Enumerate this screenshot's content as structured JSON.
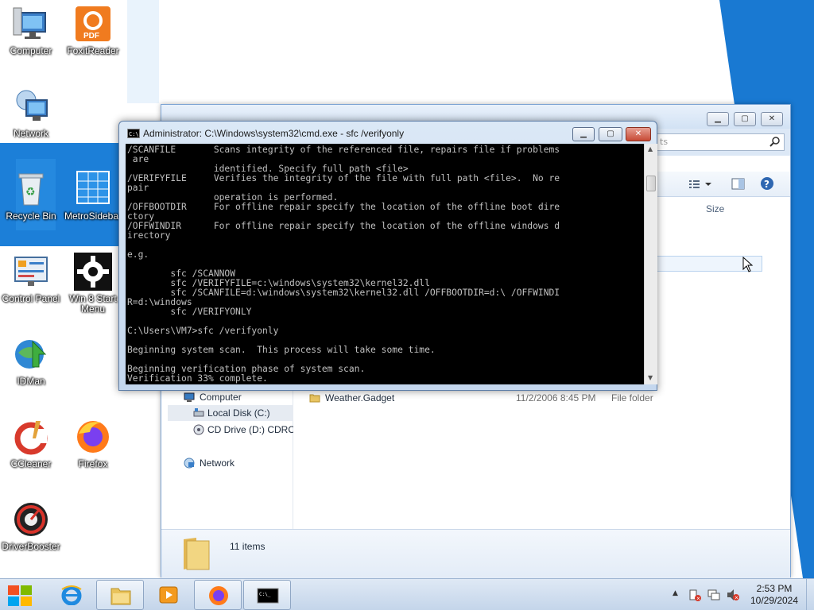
{
  "desktop": {
    "icons": [
      {
        "label": "Computer"
      },
      {
        "label": "FoxitReader"
      },
      {
        "label": "Network"
      },
      {
        "label": "Recycle Bin"
      },
      {
        "label": "MetroSidebar"
      },
      {
        "label": "Control Panel"
      },
      {
        "label": "Win 8 Start Menu"
      },
      {
        "label": "IDMan"
      },
      {
        "label": "CCleaner"
      },
      {
        "label": "Firefox"
      },
      {
        "label": "DriverBooster"
      }
    ]
  },
  "explorer": {
    "search_placeholder": "ts",
    "column_size": "Size",
    "sidebar": [
      {
        "label": "Computer",
        "icon": "computer-icon"
      },
      {
        "label": "Local Disk (C:)",
        "icon": "drive-icon"
      },
      {
        "label": "CD Drive (D:) CDROM",
        "icon": "cd-drive-icon"
      },
      {
        "label": "Network",
        "icon": "network-icon"
      }
    ],
    "files": [
      {
        "name": "Weather.Gadget",
        "date": "11/2/2006 8:45 PM",
        "type": "File folder"
      }
    ],
    "item_count": "11 items"
  },
  "cmd": {
    "title": "Administrator: C:\\Windows\\system32\\cmd.exe - sfc  /verifyonly",
    "lines": [
      "/SCANFILE       Scans integrity of the referenced file, repairs file if problems",
      " are",
      "                identified. Specify full path <file>",
      "/VERIFYFILE     Verifies the integrity of the file with full path <file>.  No re",
      "pair",
      "                operation is performed.",
      "/OFFBOOTDIR     For offline repair specify the location of the offline boot dire",
      "ctory",
      "/OFFWINDIR      For offline repair specify the location of the offline windows d",
      "irectory",
      "",
      "e.g.",
      "",
      "        sfc /SCANNOW",
      "        sfc /VERIFYFILE=c:\\windows\\system32\\kernel32.dll",
      "        sfc /SCANFILE=d:\\windows\\system32\\kernel32.dll /OFFBOOTDIR=d:\\ /OFFWINDI",
      "R=d:\\windows",
      "        sfc /VERIFYONLY",
      "",
      "C:\\Users\\VM7>sfc /verifyonly",
      "",
      "Beginning system scan.  This process will take some time.",
      "",
      "Beginning verification phase of system scan.",
      "Verification 33% complete."
    ]
  },
  "taskbar": {
    "time": "2:53 PM",
    "date": "10/29/2024",
    "buttons": [
      "start-button",
      "internet-explorer-button",
      "file-explorer-button",
      "media-player-button",
      "firefox-button",
      "cmd-button"
    ]
  },
  "colors": {
    "wallpaper_blue": "#1a7fd6",
    "console_bg": "#000000",
    "console_fg": "#c0c0c0",
    "cmd_close": "#c74a35"
  }
}
